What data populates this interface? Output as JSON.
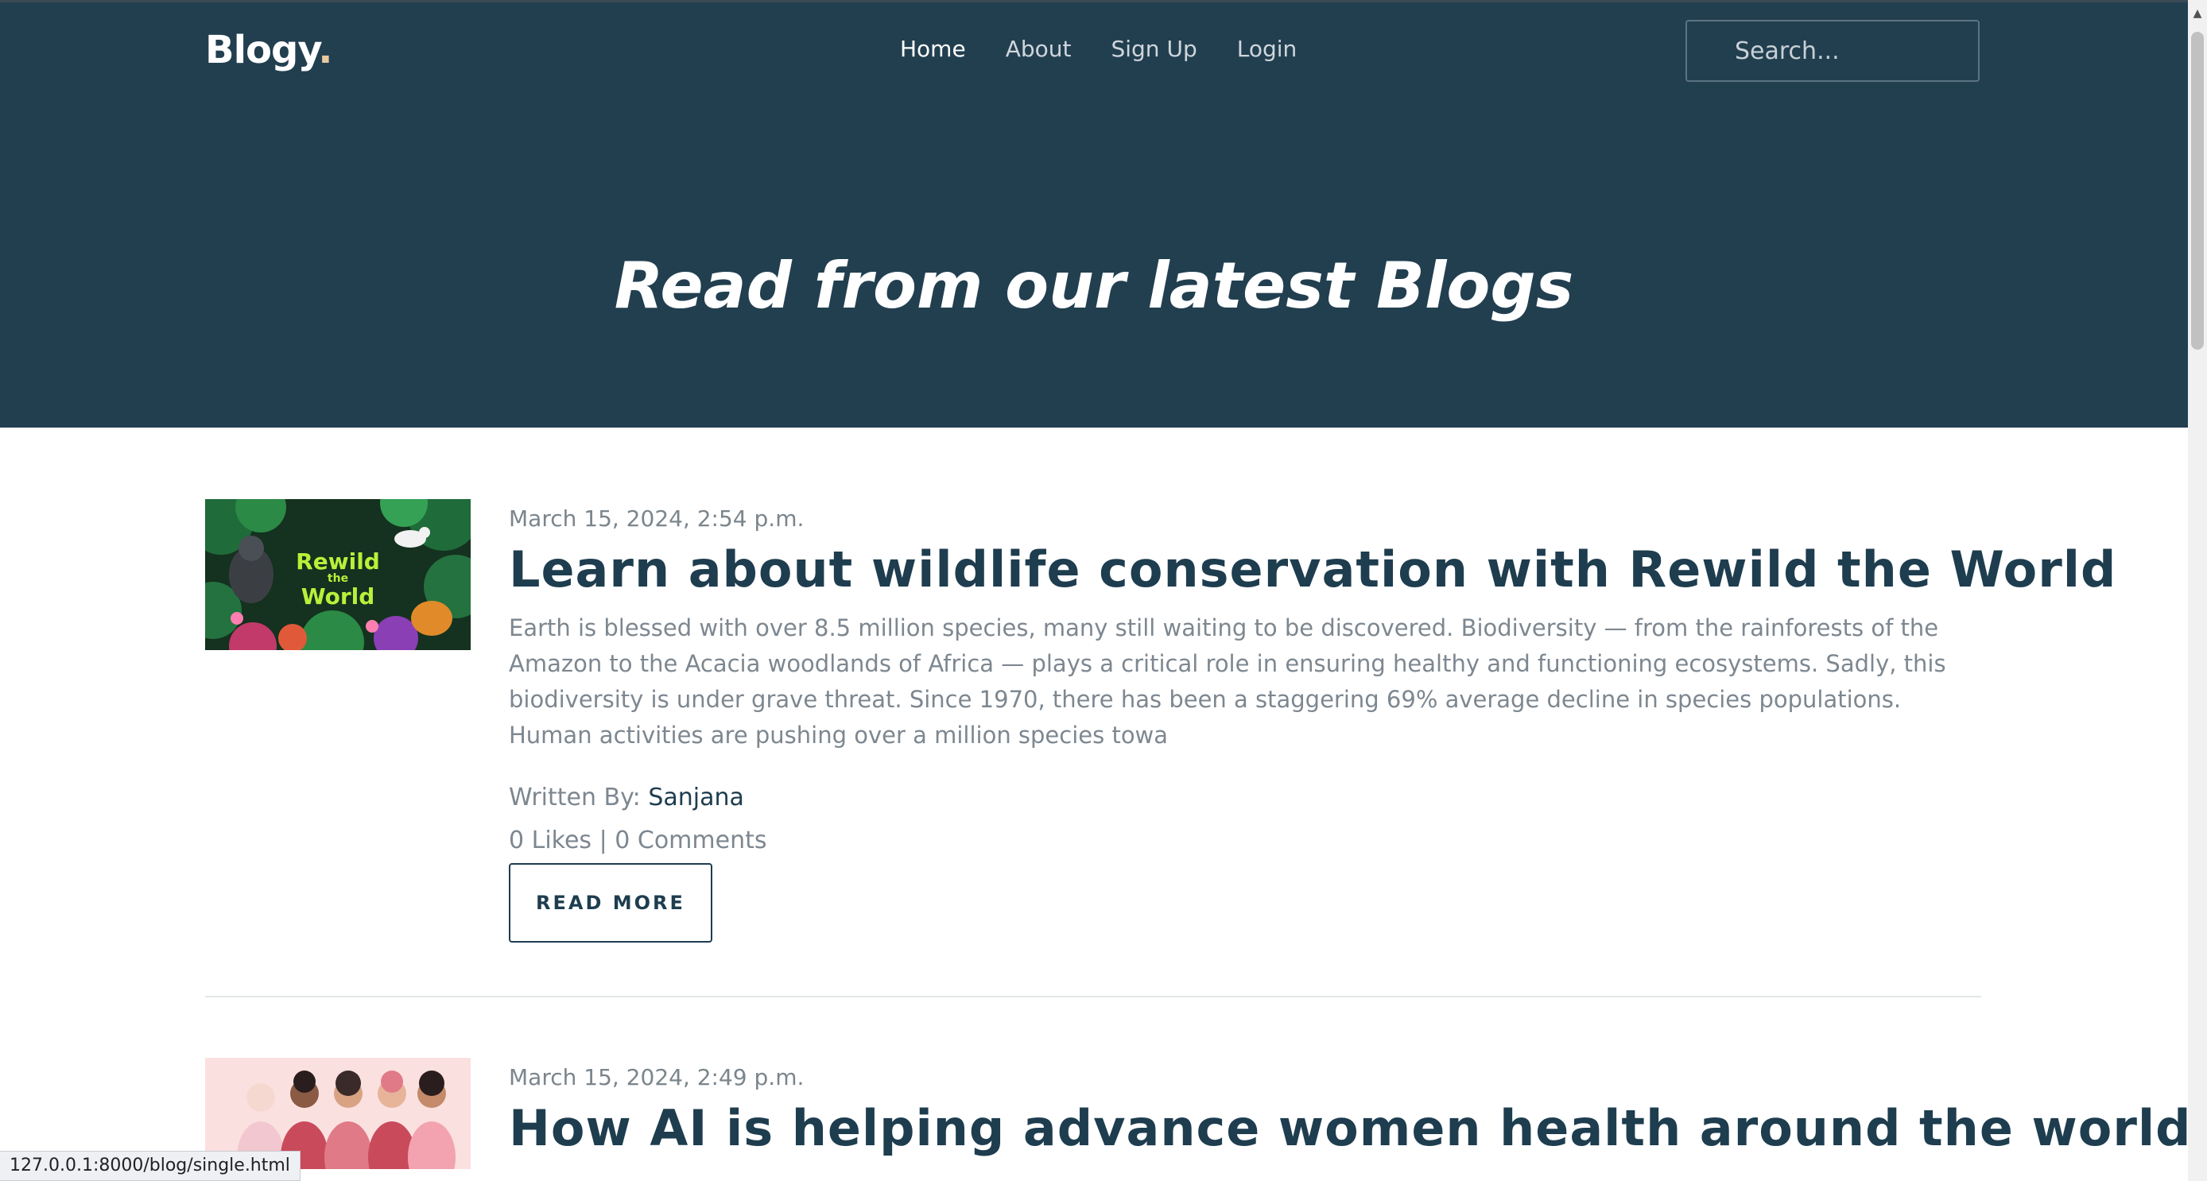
{
  "brand": {
    "name": "Blogy",
    "dot": "."
  },
  "nav": {
    "items": [
      {
        "label": "Home",
        "active": true
      },
      {
        "label": "About",
        "active": false
      },
      {
        "label": "Sign Up",
        "active": false
      },
      {
        "label": "Login",
        "active": false
      }
    ]
  },
  "search": {
    "placeholder": "Search..."
  },
  "hero": {
    "title": "Read from our latest Blogs"
  },
  "posts": [
    {
      "date": "March 15, 2024, 2:54 p.m.",
      "title": "Learn about wildlife conservation with Rewild the World",
      "excerpt": "Earth is blessed with over 8.5 million species, many still waiting to be discovered. Biodiversity — from the rainforests of the Amazon to the Acacia woodlands of Africa — plays a critical role in ensuring healthy and functioning ecosystems. Sadly, this biodiversity is under grave threat. Since 1970, there has been a staggering 69% average decline in species populations. Human activities are pushing over a million species towa",
      "author_prefix": "Written By:",
      "author": "Sanjana",
      "stats": "0 Likes | 0 Comments",
      "button": "READ MORE",
      "thumb_text_1": "Rewild",
      "thumb_text_2": "the",
      "thumb_text_3": "World"
    },
    {
      "date": "March 15, 2024, 2:49 p.m.",
      "title": "How AI is helping advance women health around the world"
    }
  ],
  "status_bar": {
    "url": "127.0.0.1:8000/blog/single.html"
  },
  "colors": {
    "header_bg": "#223f50",
    "primary_text": "#1e3d4f",
    "muted_text": "#7d8790"
  }
}
